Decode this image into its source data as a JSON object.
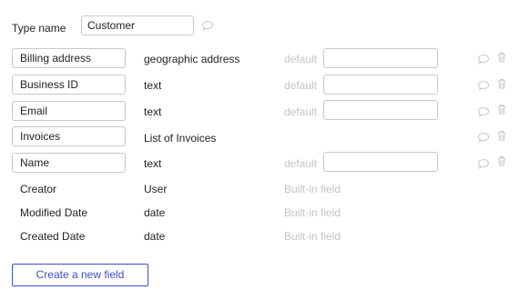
{
  "type": {
    "label": "Type name",
    "value": "Customer"
  },
  "fields": [
    {
      "name": "Billing address",
      "type": "geographic address",
      "default_label": "default",
      "default_value": ""
    },
    {
      "name": "Business ID",
      "type": "text",
      "default_label": "default",
      "default_value": ""
    },
    {
      "name": "Email",
      "type": "text",
      "default_label": "default",
      "default_value": ""
    },
    {
      "name": "Invoices",
      "type": "List of Invoices"
    },
    {
      "name": "Name",
      "type": "text",
      "default_label": "default",
      "default_value": ""
    }
  ],
  "builtin_fields": [
    {
      "name": "Creator",
      "type": "User",
      "note": "Built-in field"
    },
    {
      "name": "Modified Date",
      "type": "date",
      "note": "Built-in field"
    },
    {
      "name": "Created Date",
      "type": "date",
      "note": "Built-in field"
    }
  ],
  "actions": {
    "create_label": "Create a new field"
  },
  "icons": {
    "comment": "comment-icon",
    "trash": "trash-icon"
  },
  "colors": {
    "accent": "#3c4fc4",
    "muted": "#c4c4c4",
    "icon": "#c8c8c8"
  }
}
